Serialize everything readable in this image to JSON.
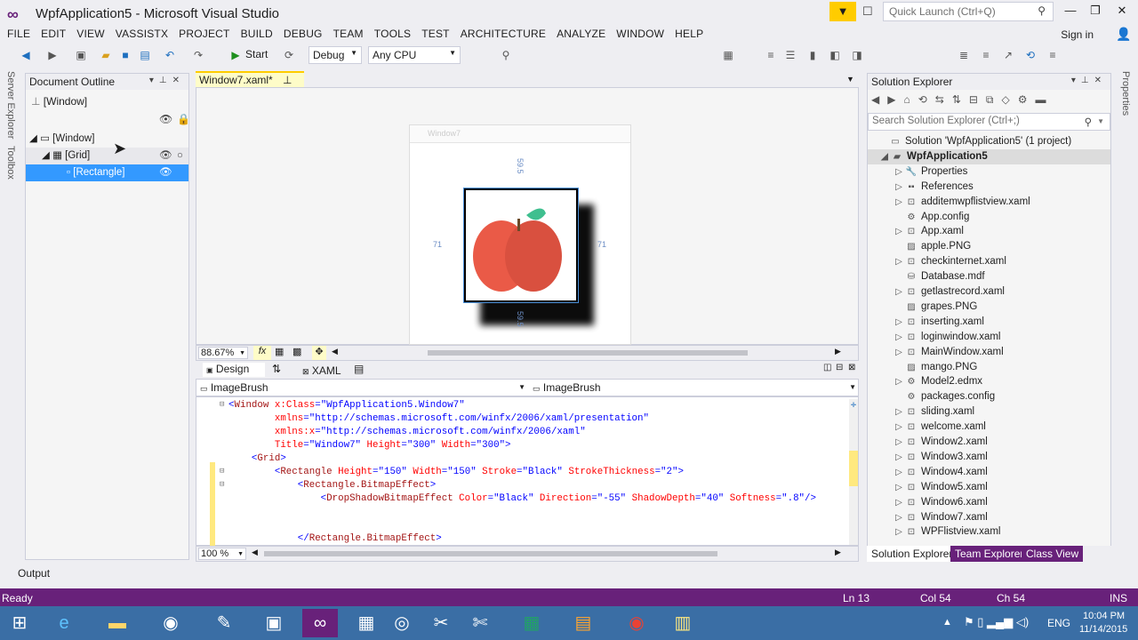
{
  "window": {
    "title": "WpfApplication5 - Microsoft Visual Studio",
    "quick_launch_placeholder": "Quick Launch (Ctrl+Q)",
    "sign_in": "Sign in"
  },
  "menu": [
    "FILE",
    "EDIT",
    "VIEW",
    "VASSISTX",
    "PROJECT",
    "BUILD",
    "DEBUG",
    "TEAM",
    "TOOLS",
    "TEST",
    "ARCHITECTURE",
    "ANALYZE",
    "WINDOW",
    "HELP"
  ],
  "toolbar": {
    "start_label": "Start",
    "config": "Debug",
    "platform": "Any CPU"
  },
  "side_tabs": {
    "server_explorer": "Server Explorer",
    "toolbox": "Toolbox",
    "properties": "Properties"
  },
  "document_outline": {
    "title": "Document Outline",
    "breadcrumb": "[Window]",
    "items": [
      {
        "label": "[Window]"
      },
      {
        "label": "[Grid]"
      },
      {
        "label": "[Rectangle]"
      }
    ]
  },
  "editor": {
    "tab_label": "Window7.xaml*",
    "design_window_title": "Window7",
    "dims": {
      "top": "59.5",
      "bottom": "59.5",
      "left": "71",
      "right": "71"
    },
    "zoom": "88.67%",
    "fx": "fx",
    "design_tab": "Design",
    "xaml_tab": "XAML",
    "combo_left": "ImageBrush",
    "combo_right": "ImageBrush",
    "code_zoom": "100 %",
    "code_lines": [
      [
        {
          "c": "bl",
          "t": "<"
        },
        {
          "c": "tg",
          "t": "Window"
        },
        {
          "c": "at",
          "t": " x:Class"
        },
        {
          "c": "bl",
          "t": "=\"WpfApplication5.Window7\""
        }
      ],
      [
        {
          "c": "at",
          "t": "        xmlns"
        },
        {
          "c": "bl",
          "t": "=\"http://schemas.microsoft.com/winfx/2006/xaml/presentation\""
        }
      ],
      [
        {
          "c": "at",
          "t": "        xmlns:x"
        },
        {
          "c": "bl",
          "t": "=\"http://schemas.microsoft.com/winfx/2006/xaml\""
        }
      ],
      [
        {
          "c": "at",
          "t": "        Title"
        },
        {
          "c": "bl",
          "t": "=\"Window7\""
        },
        {
          "c": "at",
          "t": " Height"
        },
        {
          "c": "bl",
          "t": "=\"300\""
        },
        {
          "c": "at",
          "t": " Width"
        },
        {
          "c": "bl",
          "t": "=\"300\">"
        }
      ],
      [
        {
          "c": "bl",
          "t": "    <"
        },
        {
          "c": "tg",
          "t": "Grid"
        },
        {
          "c": "bl",
          "t": ">"
        }
      ],
      [
        {
          "c": "bl",
          "t": "        <"
        },
        {
          "c": "tg",
          "t": "Rectangle"
        },
        {
          "c": "at",
          "t": " Height"
        },
        {
          "c": "bl",
          "t": "=\"150\""
        },
        {
          "c": "at",
          "t": " Width"
        },
        {
          "c": "bl",
          "t": "=\"150\""
        },
        {
          "c": "at",
          "t": " Stroke"
        },
        {
          "c": "bl",
          "t": "=\"Black\""
        },
        {
          "c": "at",
          "t": " StrokeThickness"
        },
        {
          "c": "bl",
          "t": "=\"2\">"
        }
      ],
      [
        {
          "c": "bl",
          "t": "            <"
        },
        {
          "c": "tg",
          "t": "Rectangle.BitmapEffect"
        },
        {
          "c": "bl",
          "t": ">"
        }
      ],
      [
        {
          "c": "bl",
          "t": "                <"
        },
        {
          "c": "tg",
          "t": "DropShadowBitmapEffect"
        },
        {
          "c": "at",
          "t": " Color"
        },
        {
          "c": "bl",
          "t": "=\"Black\""
        },
        {
          "c": "at",
          "t": " Direction"
        },
        {
          "c": "bl",
          "t": "=\"-55\""
        },
        {
          "c": "at",
          "t": " ShadowDepth"
        },
        {
          "c": "bl",
          "t": "=\"40\""
        },
        {
          "c": "at",
          "t": " Softness"
        },
        {
          "c": "bl",
          "t": "=\".8\"/>"
        }
      ],
      [
        {
          "c": "bl",
          "t": ""
        }
      ],
      [
        {
          "c": "bl",
          "t": ""
        }
      ],
      [
        {
          "c": "bl",
          "t": "            </"
        },
        {
          "c": "tg",
          "t": "Rectangle.BitmapEffect"
        },
        {
          "c": "bl",
          "t": ">"
        }
      ]
    ]
  },
  "solution_explorer": {
    "title": "Solution Explorer",
    "search_placeholder": "Search Solution Explorer (Ctrl+;)",
    "items": [
      {
        "label": "Solution 'WpfApplication5' (1 project)",
        "icon": "solution-icon"
      },
      {
        "label": "WpfApplication5",
        "icon": "csharp-project-icon"
      },
      {
        "label": "Properties",
        "icon": "wrench-icon"
      },
      {
        "label": "References",
        "icon": "references-icon"
      },
      {
        "label": "additemwpflistview.xaml",
        "icon": "xaml-file-icon"
      },
      {
        "label": "App.config",
        "icon": "config-file-icon"
      },
      {
        "label": "App.xaml",
        "icon": "xaml-file-icon"
      },
      {
        "label": "apple.PNG",
        "icon": "image-file-icon"
      },
      {
        "label": "checkinternet.xaml",
        "icon": "xaml-file-icon"
      },
      {
        "label": "Database.mdf",
        "icon": "database-icon"
      },
      {
        "label": "getlastrecord.xaml",
        "icon": "xaml-file-icon"
      },
      {
        "label": "grapes.PNG",
        "icon": "image-file-icon"
      },
      {
        "label": "inserting.xaml",
        "icon": "xaml-file-icon"
      },
      {
        "label": "loginwindow.xaml",
        "icon": "xaml-file-icon"
      },
      {
        "label": "MainWindow.xaml",
        "icon": "xaml-file-icon"
      },
      {
        "label": "mango.PNG",
        "icon": "image-file-icon"
      },
      {
        "label": "Model2.edmx",
        "icon": "edmx-file-icon"
      },
      {
        "label": "packages.config",
        "icon": "config-file-icon"
      },
      {
        "label": "sliding.xaml",
        "icon": "xaml-file-icon"
      },
      {
        "label": "welcome.xaml",
        "icon": "xaml-file-icon"
      },
      {
        "label": "Window2.xaml",
        "icon": "xaml-file-icon"
      },
      {
        "label": "Window3.xaml",
        "icon": "xaml-file-icon"
      },
      {
        "label": "Window4.xaml",
        "icon": "xaml-file-icon"
      },
      {
        "label": "Window5.xaml",
        "icon": "xaml-file-icon"
      },
      {
        "label": "Window6.xaml",
        "icon": "xaml-file-icon"
      },
      {
        "label": "Window7.xaml",
        "icon": "xaml-file-icon"
      },
      {
        "label": "WPFlistview.xaml",
        "icon": "xaml-file-icon"
      }
    ],
    "tabs": [
      "Solution Explorer",
      "Team Explorer",
      "Class View"
    ]
  },
  "output_tab": "Output",
  "status": {
    "text": "Ready",
    "ln": "Ln 13",
    "col": "Col 54",
    "ch": "Ch 54",
    "mode": "INS"
  },
  "taskbar": {
    "lang": "ENG",
    "time": "10:04 PM",
    "date": "11/14/2015"
  },
  "colors": {
    "accent": "#68217a",
    "highlight": "#ffcc00",
    "selection": "#3399ff",
    "taskbar": "#3a6ea5"
  }
}
